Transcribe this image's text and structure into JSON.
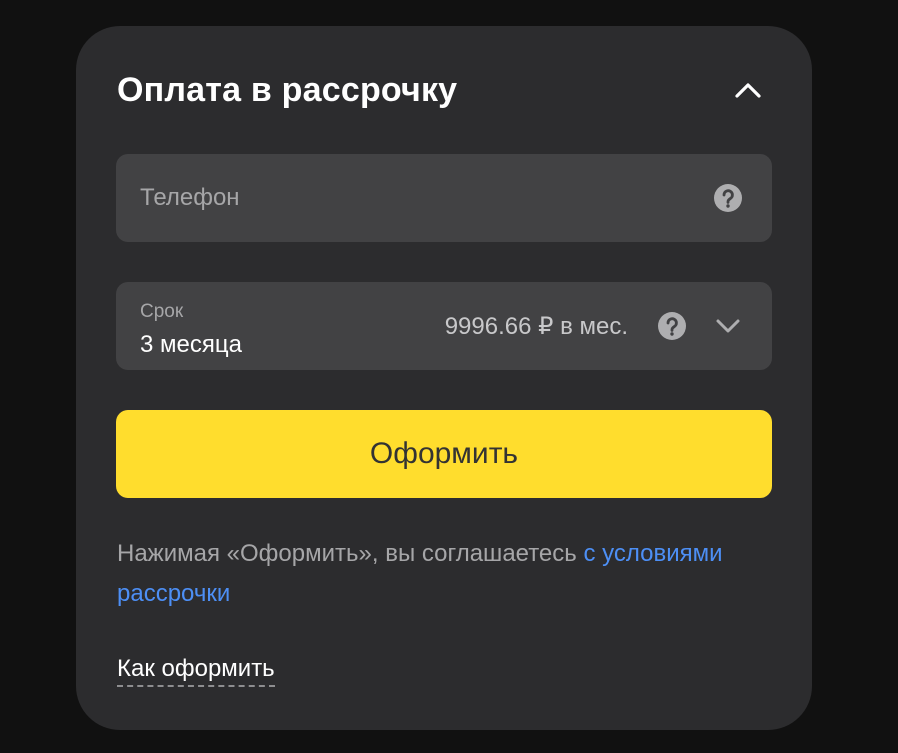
{
  "form": {
    "title": "Оплата в рассрочку",
    "collapse_icon": "chevron-up-icon",
    "phone": {
      "placeholder": "Телефон",
      "value": "",
      "help_icon": "question-circle-icon"
    },
    "term": {
      "label": "Срок",
      "selected": "3 месяца",
      "monthly_payment": "9996.66 ₽ в мес.",
      "help_icon": "question-circle-icon",
      "dropdown_icon": "chevron-down-icon"
    },
    "submit_label": "Оформить",
    "agreement_text": "Нажимая «Оформить», вы соглашаетесь ",
    "agreement_link": "с условиями рассрочки",
    "how_to_link": "Как оформить"
  },
  "colors": {
    "background": "#111111",
    "card": "#2c2c2e",
    "field": "#424244",
    "accent_button": "#ffdd2d",
    "link": "#4d8ff5",
    "muted_text": "#a6a6a8"
  }
}
